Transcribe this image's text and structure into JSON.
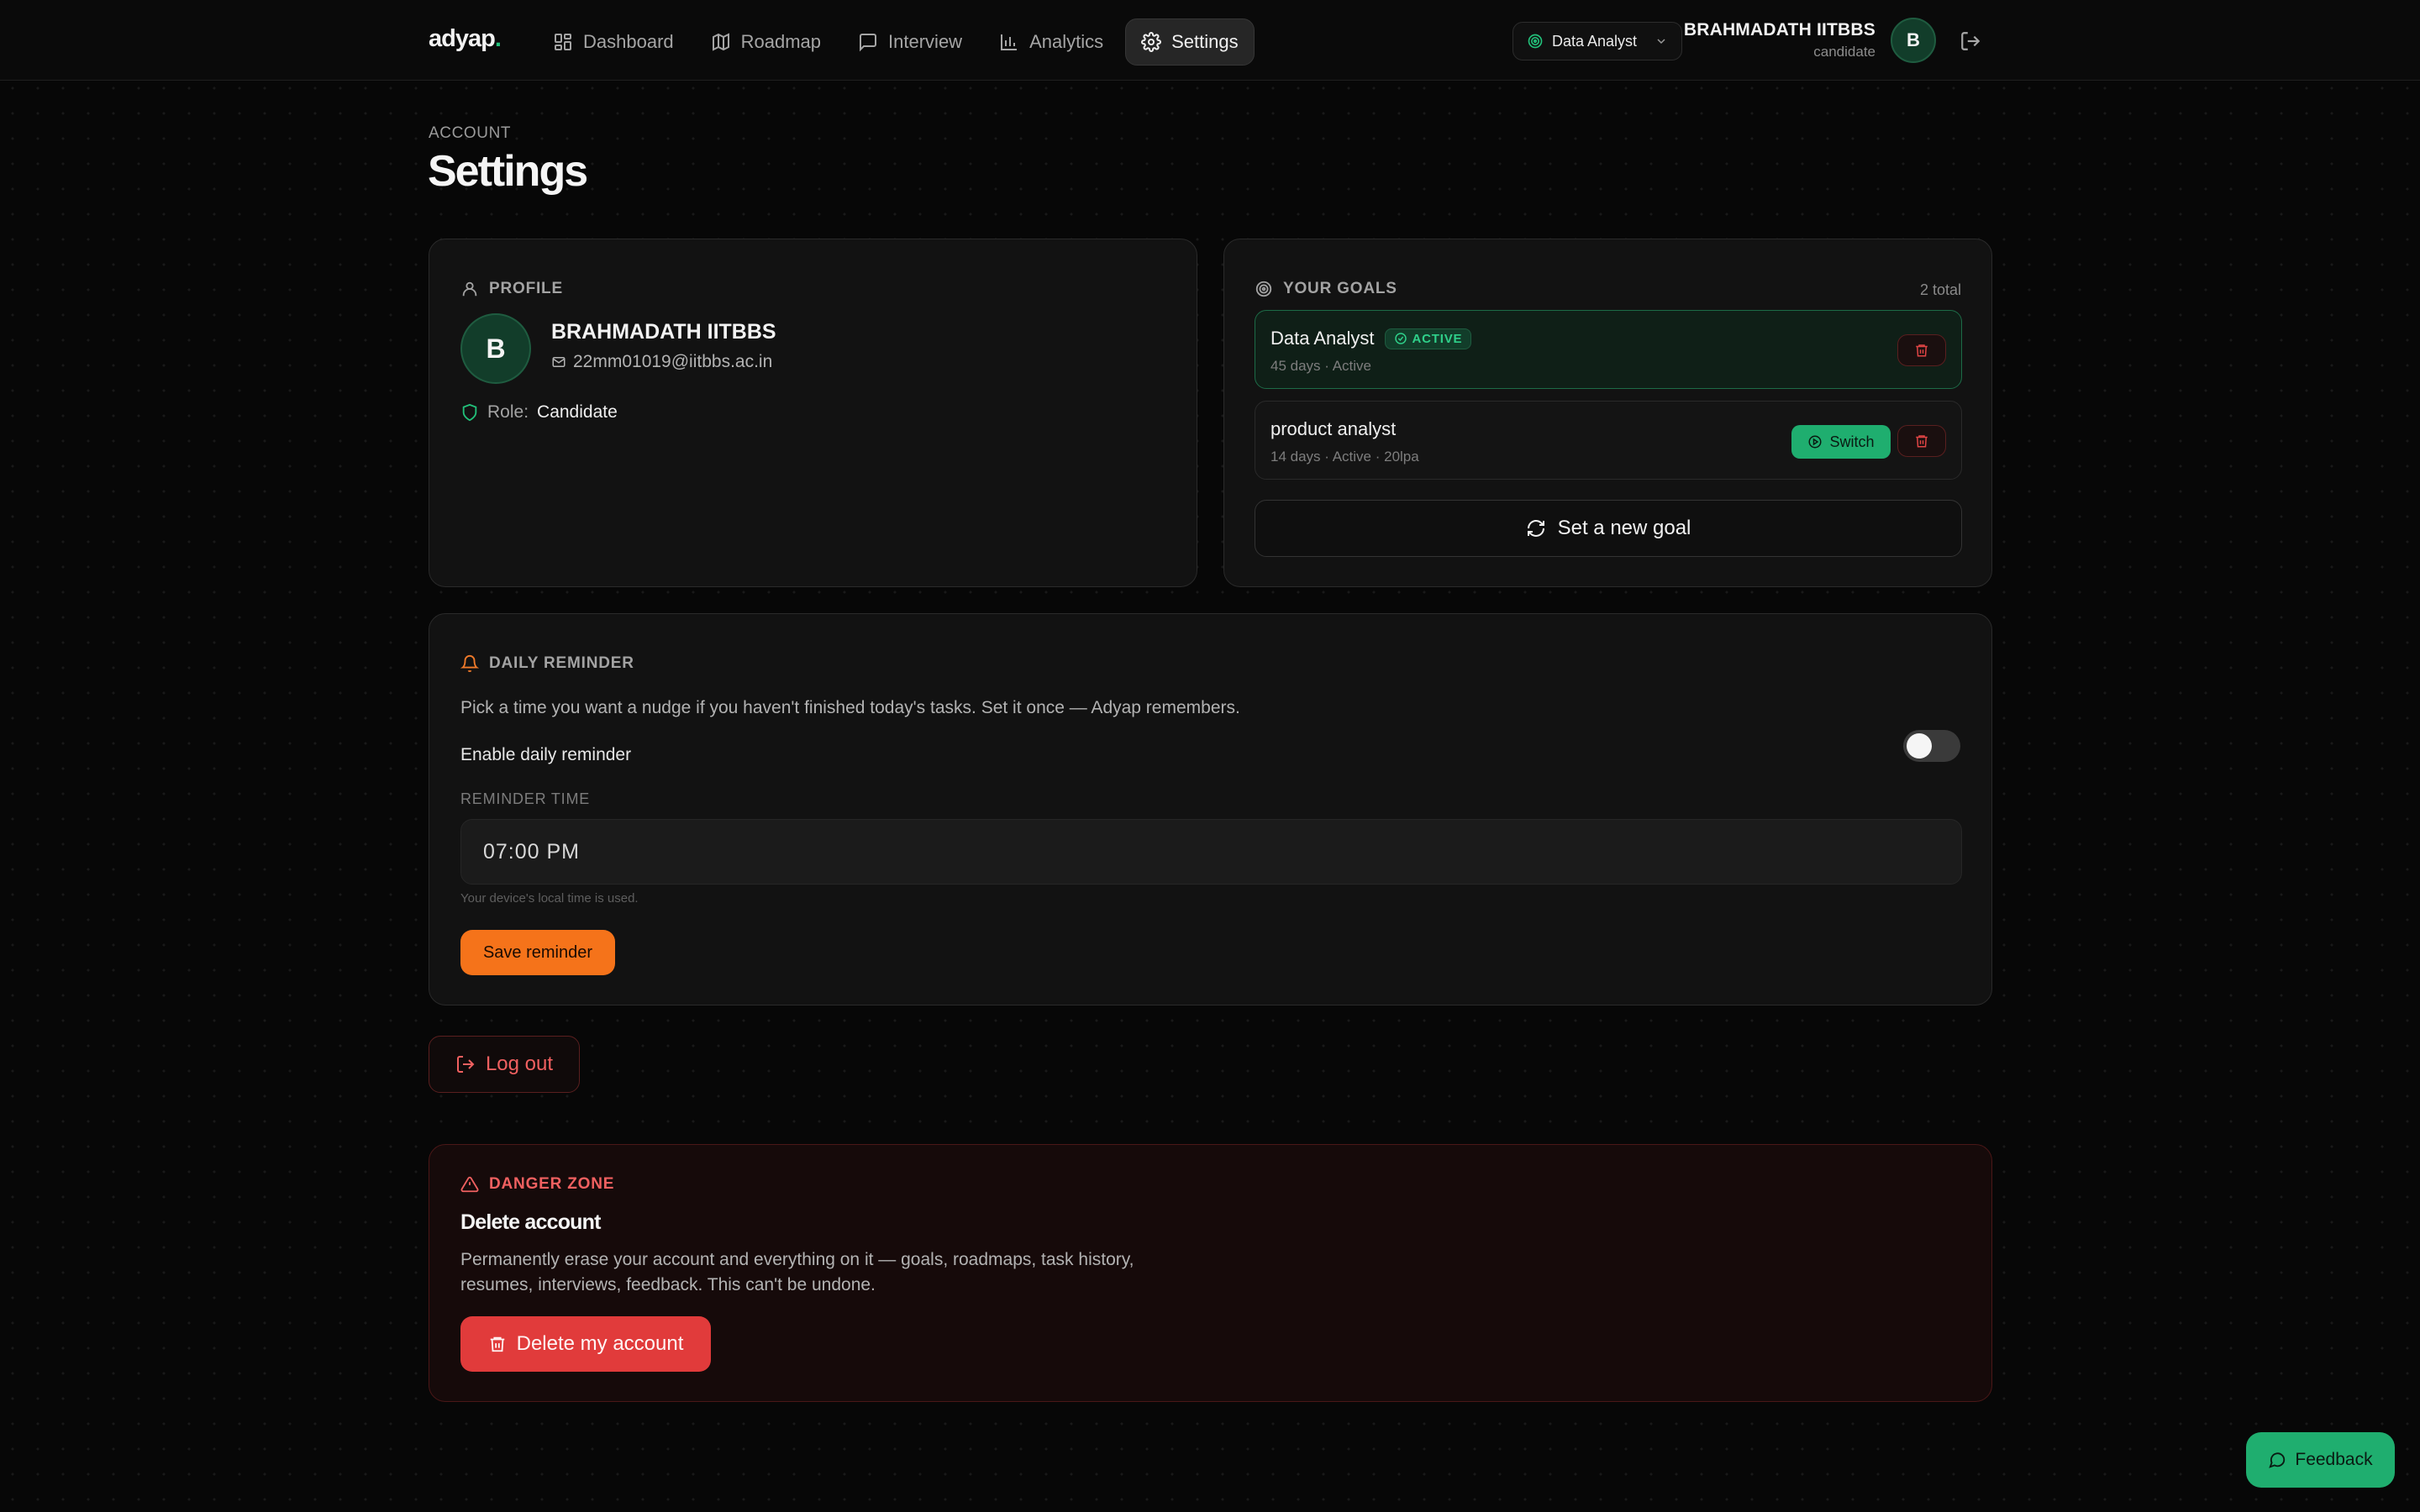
{
  "nav": {
    "logo": "adyap",
    "logo_dot": ".",
    "links": [
      {
        "label": "Dashboard",
        "icon": "dashboard-icon"
      },
      {
        "label": "Roadmap",
        "icon": "map-icon"
      },
      {
        "label": "Interview",
        "icon": "chat-icon"
      },
      {
        "label": "Analytics",
        "icon": "bar-chart-icon"
      },
      {
        "label": "Settings",
        "icon": "gear-icon",
        "active": true
      }
    ],
    "goal_selector": "Data Analyst",
    "user_name": "BRAHMADATH IITBBS",
    "user_role": "candidate",
    "avatar_initial": "B"
  },
  "header": {
    "eyebrow": "ACCOUNT",
    "title": "Settings"
  },
  "profile": {
    "section_label": "PROFILE",
    "avatar_initial": "B",
    "name": "BRAHMADATH IITBBS",
    "email": "22mm01019@iitbbs.ac.in",
    "role_label": "Role:",
    "role_value": "Candidate"
  },
  "goals": {
    "section_label": "YOUR GOALS",
    "count": "2 total",
    "items": [
      {
        "name": "Data Analyst",
        "badge": "ACTIVE",
        "meta": "45 days · Active",
        "active": true
      },
      {
        "name": "product analyst",
        "meta": "14 days · Active · 20lpa",
        "switch_label": "Switch"
      }
    ],
    "new_goal_label": "Set a new goal"
  },
  "reminder": {
    "section_label": "DAILY REMINDER",
    "description": "Pick a time you want a nudge if you haven't finished today's tasks. Set it once — Adyap remembers.",
    "enable_label": "Enable daily reminder",
    "enabled": false,
    "time_label": "REMINDER TIME",
    "time_value": "07:00 PM",
    "help": "Your device's local time is used.",
    "save_label": "Save reminder"
  },
  "logout_label": "Log out",
  "danger": {
    "section_label": "DANGER ZONE",
    "title": "Delete account",
    "description": "Permanently erase your account and everything on it — goals, roadmaps, task history, resumes, interviews, feedback. This can't be undone.",
    "delete_label": "Delete my account"
  },
  "feedback_label": "Feedback",
  "colors": {
    "accent_green": "#1fae6f",
    "accent_orange": "#f5731a",
    "danger_red": "#e13b3b",
    "background": "#070707"
  }
}
